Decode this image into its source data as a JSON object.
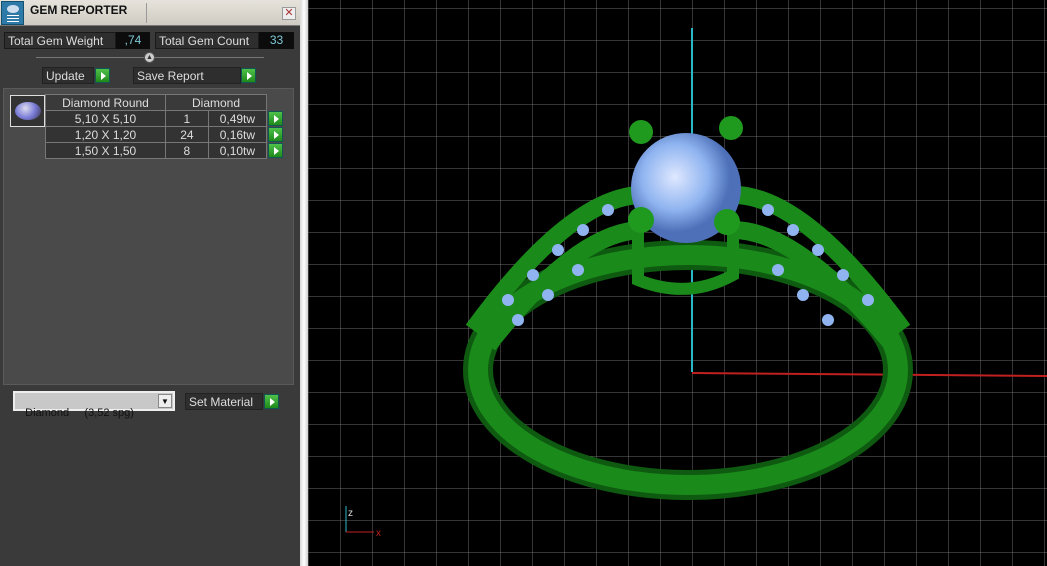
{
  "window": {
    "title": "GEM REPORTER",
    "close_icon": "close-icon"
  },
  "totals": {
    "weight_label": "Total Gem Weight",
    "weight_value": ",74",
    "count_label": "Total Gem Count",
    "count_value": "33"
  },
  "buttons": {
    "update": "Update",
    "save_report": "Save Report",
    "set_material": "Set Material"
  },
  "table": {
    "headers": [
      "Diamond Round",
      "Diamond"
    ],
    "rows": [
      {
        "size": "5,10 X 5,10",
        "count": "1",
        "weight": "0,49tw"
      },
      {
        "size": "1,20 X 1,20",
        "count": "24",
        "weight": "0,16tw"
      },
      {
        "size": "1,50 X 1,50",
        "count": "8",
        "weight": "0,10tw"
      }
    ]
  },
  "material": {
    "selected": "Diamond     (3,52 spg)"
  },
  "viewport": {
    "axis_labels": {
      "z": "z",
      "x": "x"
    },
    "colors": {
      "ring": "#1a8a1a",
      "gem": "#8fb4f0",
      "axis_y": "#2ab8c8",
      "axis_x": "#c02020"
    }
  }
}
